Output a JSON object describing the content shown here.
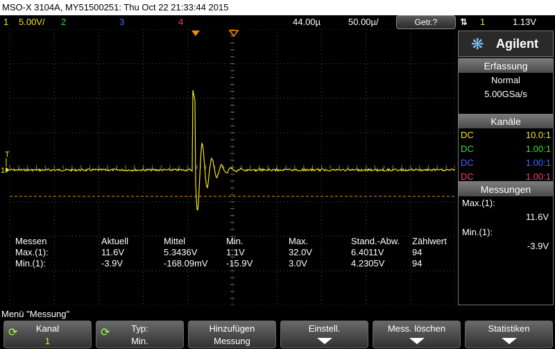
{
  "window": {
    "title": "MSO-X 3104A, MY51500251: Thu Oct 22 21:33:44 2015"
  },
  "channel_bar": {
    "ch1_num": "1",
    "ch1_scale": "5.00V/",
    "ch2_num": "2",
    "ch3_num": "3",
    "ch4_num": "4",
    "time_delay": "44.00µ",
    "time_scale": "50.00µ/",
    "run_mode": "Getr.?",
    "trigger_source": "1",
    "trigger_level": "1.13V"
  },
  "colors": {
    "ch1": "#f5e61e",
    "ch2": "#37e23a",
    "ch3": "#4a63ff",
    "ch4": "#ff3b6b",
    "trigger_marker": "#ff8a00",
    "grid": "#6b6b6b"
  },
  "screen": {
    "trigger_marker_label": "T",
    "ground_marker_label": "1"
  },
  "measurements_table": {
    "headers": [
      "Messen",
      "Aktuell",
      "Mittel",
      "Min.",
      "Max.",
      "Stand.-Abw.",
      "Zählwert"
    ],
    "rows": [
      [
        "Max.(1):",
        "11.6V",
        "5.3436V",
        "1.1V",
        "32.0V",
        "6.4011V",
        "94"
      ],
      [
        "Min.(1):",
        "-3.9V",
        "-168.09mV",
        "-15.9V",
        "3.0V",
        "4.2305V",
        "94"
      ]
    ]
  },
  "right_panel": {
    "brand": "Agilent",
    "acquisition_title": "Erfassung",
    "acquisition_mode": "Normal",
    "sample_rate": "5.00GSa/s",
    "channels_title": "Kanäle",
    "channels": [
      {
        "coupling": "DC",
        "probe": "10.0:1"
      },
      {
        "coupling": "DC",
        "probe": "1.00:1"
      },
      {
        "coupling": "DC",
        "probe": "1.00:1"
      },
      {
        "coupling": "DC",
        "probe": "1.00:1"
      }
    ],
    "measurements_title": "Messungen",
    "meas1_label": "Max.(1):",
    "meas1_value": "11.6V",
    "meas2_label": "Min.(1):",
    "meas2_value": "-3.9V"
  },
  "menu": {
    "title": "Menü \"Messung\"",
    "softkeys": [
      {
        "line1": "Kanal",
        "line2": "1"
      },
      {
        "line1": "Typ:",
        "line2": "Min."
      },
      {
        "line1": "Hinzufügen",
        "line2": "Messung"
      },
      {
        "line1": "Einstell.",
        "line2": ""
      },
      {
        "line1": "Mess. löschen",
        "line2": ""
      },
      {
        "line1": "Statistiken",
        "line2": ""
      }
    ]
  }
}
